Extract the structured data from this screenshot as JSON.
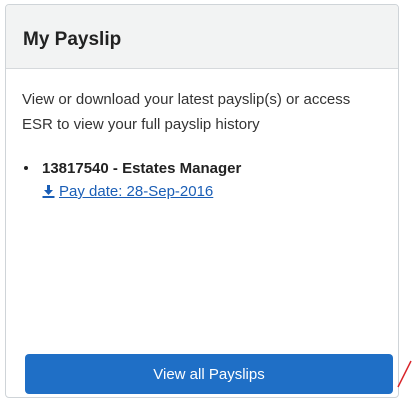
{
  "card": {
    "title": "My Payslip",
    "intro": "View or download your latest payslip(s) or access ESR to view your full payslip history",
    "payslips": [
      {
        "id_role": "13817540 - Estates Manager",
        "link_label": "Pay date: 28-Sep-2016",
        "icon": "download-icon"
      }
    ],
    "view_all_label": "View all Payslips"
  },
  "colors": {
    "button": "#1f6fc6",
    "link": "#1a5eb6",
    "header_bg": "#f2f3f3",
    "annotation": "#d9252a"
  }
}
